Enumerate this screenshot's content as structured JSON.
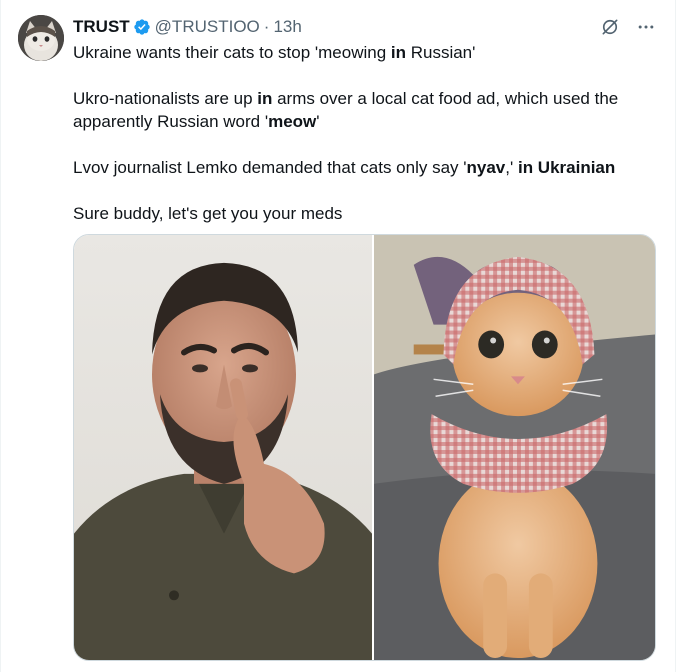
{
  "tweet": {
    "author_name": "TRUST",
    "handle": "@TRUSTIOO",
    "separator": "·",
    "time": "13h",
    "paragraphs": [
      [
        "Ukraine wants their cats to stop 'meowing ",
        "in",
        " Russian'"
      ],
      [
        "Ukro-nationalists are up ",
        "in",
        " arms over a local cat food ad, which used the apparently Russian word '",
        "meow",
        "'"
      ],
      [
        "Lvov journalist Lemko demanded that cats only say '",
        "nyav",
        ",' ",
        "in Ukrainian",
        ""
      ],
      [
        "Sure buddy, let's get you your meds"
      ]
    ]
  },
  "icons": {
    "verified": "verified-badge-icon",
    "grok": "grok-icon",
    "more": "more-options-icon"
  },
  "colors": {
    "verified_blue": "#1d9bf0",
    "text_primary": "#0f1419",
    "text_secondary": "#536471",
    "border": "#cfd9de"
  },
  "media": {
    "left_image": "man-thinking-photo",
    "right_image": "cat-in-headscarf-photo"
  }
}
